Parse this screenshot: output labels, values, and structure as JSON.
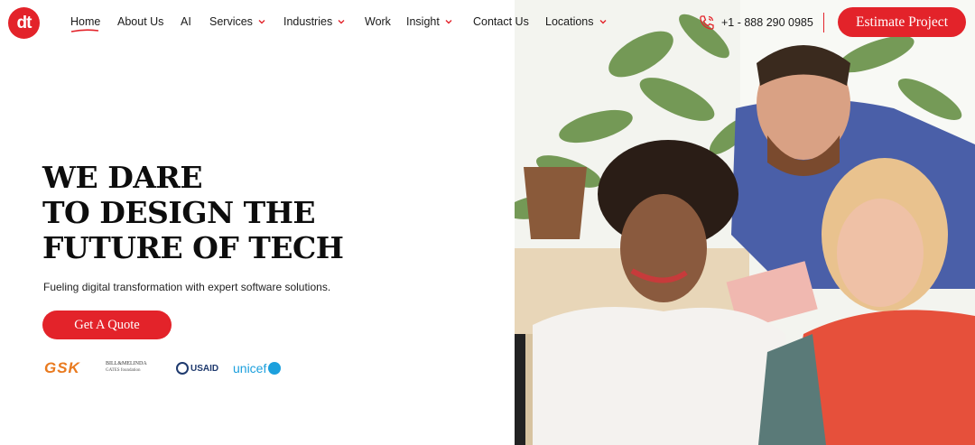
{
  "brand": {
    "logo_text": "dt",
    "accent_color": "#e3232a"
  },
  "nav": {
    "items": [
      {
        "label": "Home",
        "active": true,
        "has_dropdown": false
      },
      {
        "label": "About Us",
        "has_dropdown": false
      },
      {
        "label": "AI",
        "has_dropdown": false
      },
      {
        "label": "Services",
        "has_dropdown": true
      },
      {
        "label": "Industries",
        "has_dropdown": true
      },
      {
        "label": "Work",
        "has_dropdown": false
      },
      {
        "label": "Insight",
        "has_dropdown": true
      },
      {
        "label": "Contact Us",
        "has_dropdown": false
      },
      {
        "label": "Locations",
        "has_dropdown": true
      }
    ]
  },
  "contact": {
    "phone": "+1 - 888 290 0985",
    "icon": "phone-icon"
  },
  "header": {
    "cta_label": "Estimate Project"
  },
  "hero": {
    "headline_lines": [
      "WE DARE",
      "TO DESIGN THE",
      "FUTURE OF TECH"
    ],
    "subtitle": "Fueling digital transformation with expert software solutions.",
    "cta_label": "Get A Quote"
  },
  "clients": {
    "gsk": "GSK",
    "gates_line1": "BILL&MELINDA",
    "gates_line2": "GATES foundation",
    "usaid": "USAID",
    "unicef": "unicef"
  }
}
